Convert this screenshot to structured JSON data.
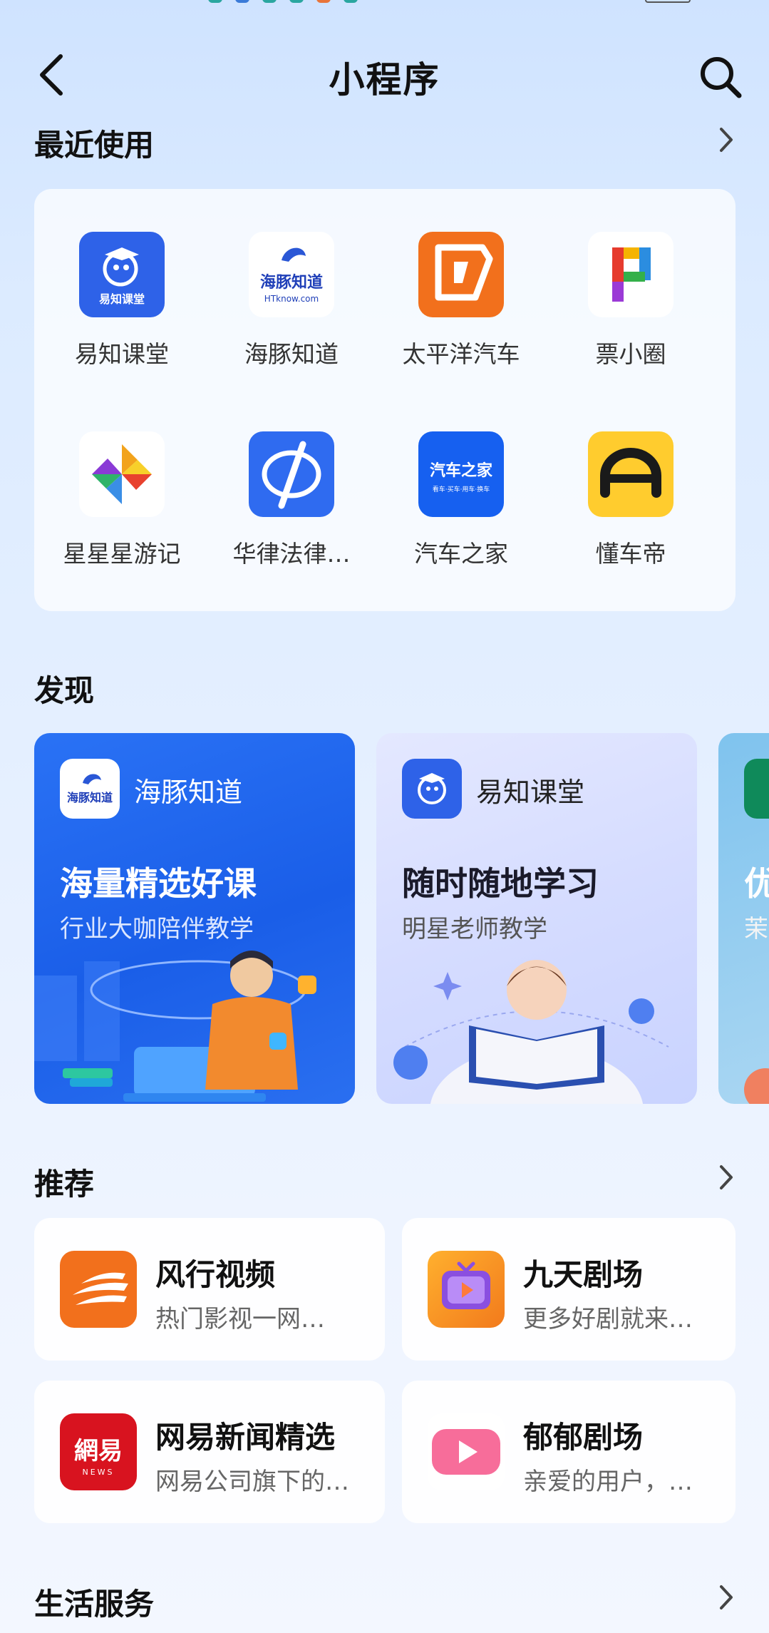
{
  "header": {
    "title": "小程序"
  },
  "recent": {
    "title": "最近使用",
    "apps": [
      {
        "label": "易知课堂",
        "icon": "yizhi-ketang-logo-icon"
      },
      {
        "label": "海豚知道",
        "icon": "haitun-zhidao-logo-icon"
      },
      {
        "label": "太平洋汽车",
        "icon": "pacific-auto-logo-icon"
      },
      {
        "label": "票小圈",
        "icon": "piao-xiaoquan-logo-icon"
      },
      {
        "label": "星星星游记",
        "icon": "xingxing-youji-logo-icon"
      },
      {
        "label": "华律法律…",
        "icon": "hualv-legal-logo-icon"
      },
      {
        "label": "汽车之家",
        "icon": "autohome-logo-icon"
      },
      {
        "label": "懂车帝",
        "icon": "dongchedi-logo-icon"
      }
    ],
    "logo_text": {
      "yizhi": "易知课堂",
      "haitun_cn": "海豚知道",
      "haitun_en": "HTknow.com",
      "autohome_cn": "汽车之家",
      "autohome_sub": "看车·买车·用车·换车"
    }
  },
  "discover": {
    "title": "发现",
    "cards": [
      {
        "name": "海豚知道",
        "headline": "海量精选好课",
        "sub": "行业大咖陪伴教学",
        "logo_text": "海豚知道"
      },
      {
        "name": "易知课堂",
        "headline": "随时随地学习",
        "sub": "明星老师教学"
      },
      {
        "headline": "优",
        "sub": "茉"
      }
    ]
  },
  "recommend": {
    "title": "推荐",
    "items": [
      {
        "name": "风行视频",
        "desc": "热门影视一网…",
        "icon": "fengxing-video-logo-icon"
      },
      {
        "name": "九天剧场",
        "desc": "更多好剧就来…",
        "icon": "jiutian-theater-logo-icon"
      },
      {
        "name": "网易新闻精选",
        "desc": "网易公司旗下的…",
        "icon": "netease-news-logo-icon",
        "logo_cn": "網易",
        "logo_en": "NEWS"
      },
      {
        "name": "郁郁剧场",
        "desc": "亲爱的用户，…",
        "icon": "yuyu-theater-logo-icon"
      }
    ]
  },
  "life": {
    "title": "生活服务"
  },
  "colors": {
    "blue": "#2f6bf0",
    "orange": "#f2701c",
    "yellow": "#ffcc2e",
    "netease_red": "#d8131f"
  }
}
